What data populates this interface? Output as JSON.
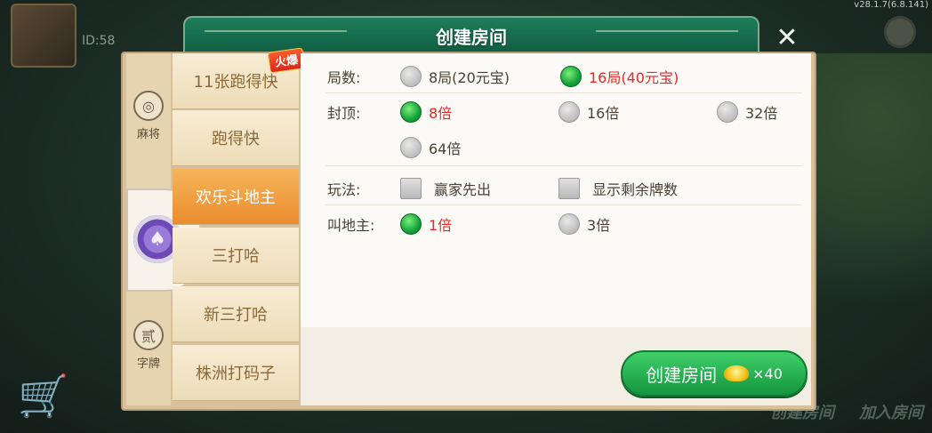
{
  "background": {
    "id_text": "ID:58",
    "version": "v28.1.7(6.8.141)",
    "bottom_buttons": [
      "创建房间",
      "加入房间"
    ]
  },
  "dialog": {
    "title": "创建房间",
    "close_label": "✕"
  },
  "categories": [
    {
      "label": "麻将",
      "icon": "majiang-icon",
      "glyph": "◎"
    },
    {
      "label": "",
      "icon": "poker-chip-icon",
      "glyph": "♠"
    },
    {
      "label": "字牌",
      "icon": "zipai-icon",
      "glyph": "贰"
    }
  ],
  "games": [
    {
      "label": "11张跑得快",
      "badge": "火爆"
    },
    {
      "label": "跑得快"
    },
    {
      "label": "欢乐斗地主",
      "active": true
    },
    {
      "label": "三打哈"
    },
    {
      "label": "新三打哈"
    },
    {
      "label": "株洲打码子"
    }
  ],
  "options": {
    "rounds": {
      "label": "局数:",
      "choices": [
        "8局(20元宝)",
        "16局(40元宝)"
      ],
      "selected": "16局(40元宝)"
    },
    "cap": {
      "label": "封顶:",
      "choices": [
        "8倍",
        "16倍",
        "32倍",
        "64倍"
      ],
      "selected": "8倍"
    },
    "play": {
      "label": "玩法:",
      "checks": [
        "赢家先出",
        "显示剩余牌数"
      ]
    },
    "call": {
      "label": "叫地主:",
      "choices": [
        "1倍",
        "3倍"
      ],
      "selected": "1倍"
    }
  },
  "create_button": {
    "label": "创建房间",
    "cost": "×40"
  },
  "colors": {
    "accent_green": "#14963d",
    "selected_red": "#e02b2b",
    "active_tab_orange": "#ea8d2e"
  }
}
